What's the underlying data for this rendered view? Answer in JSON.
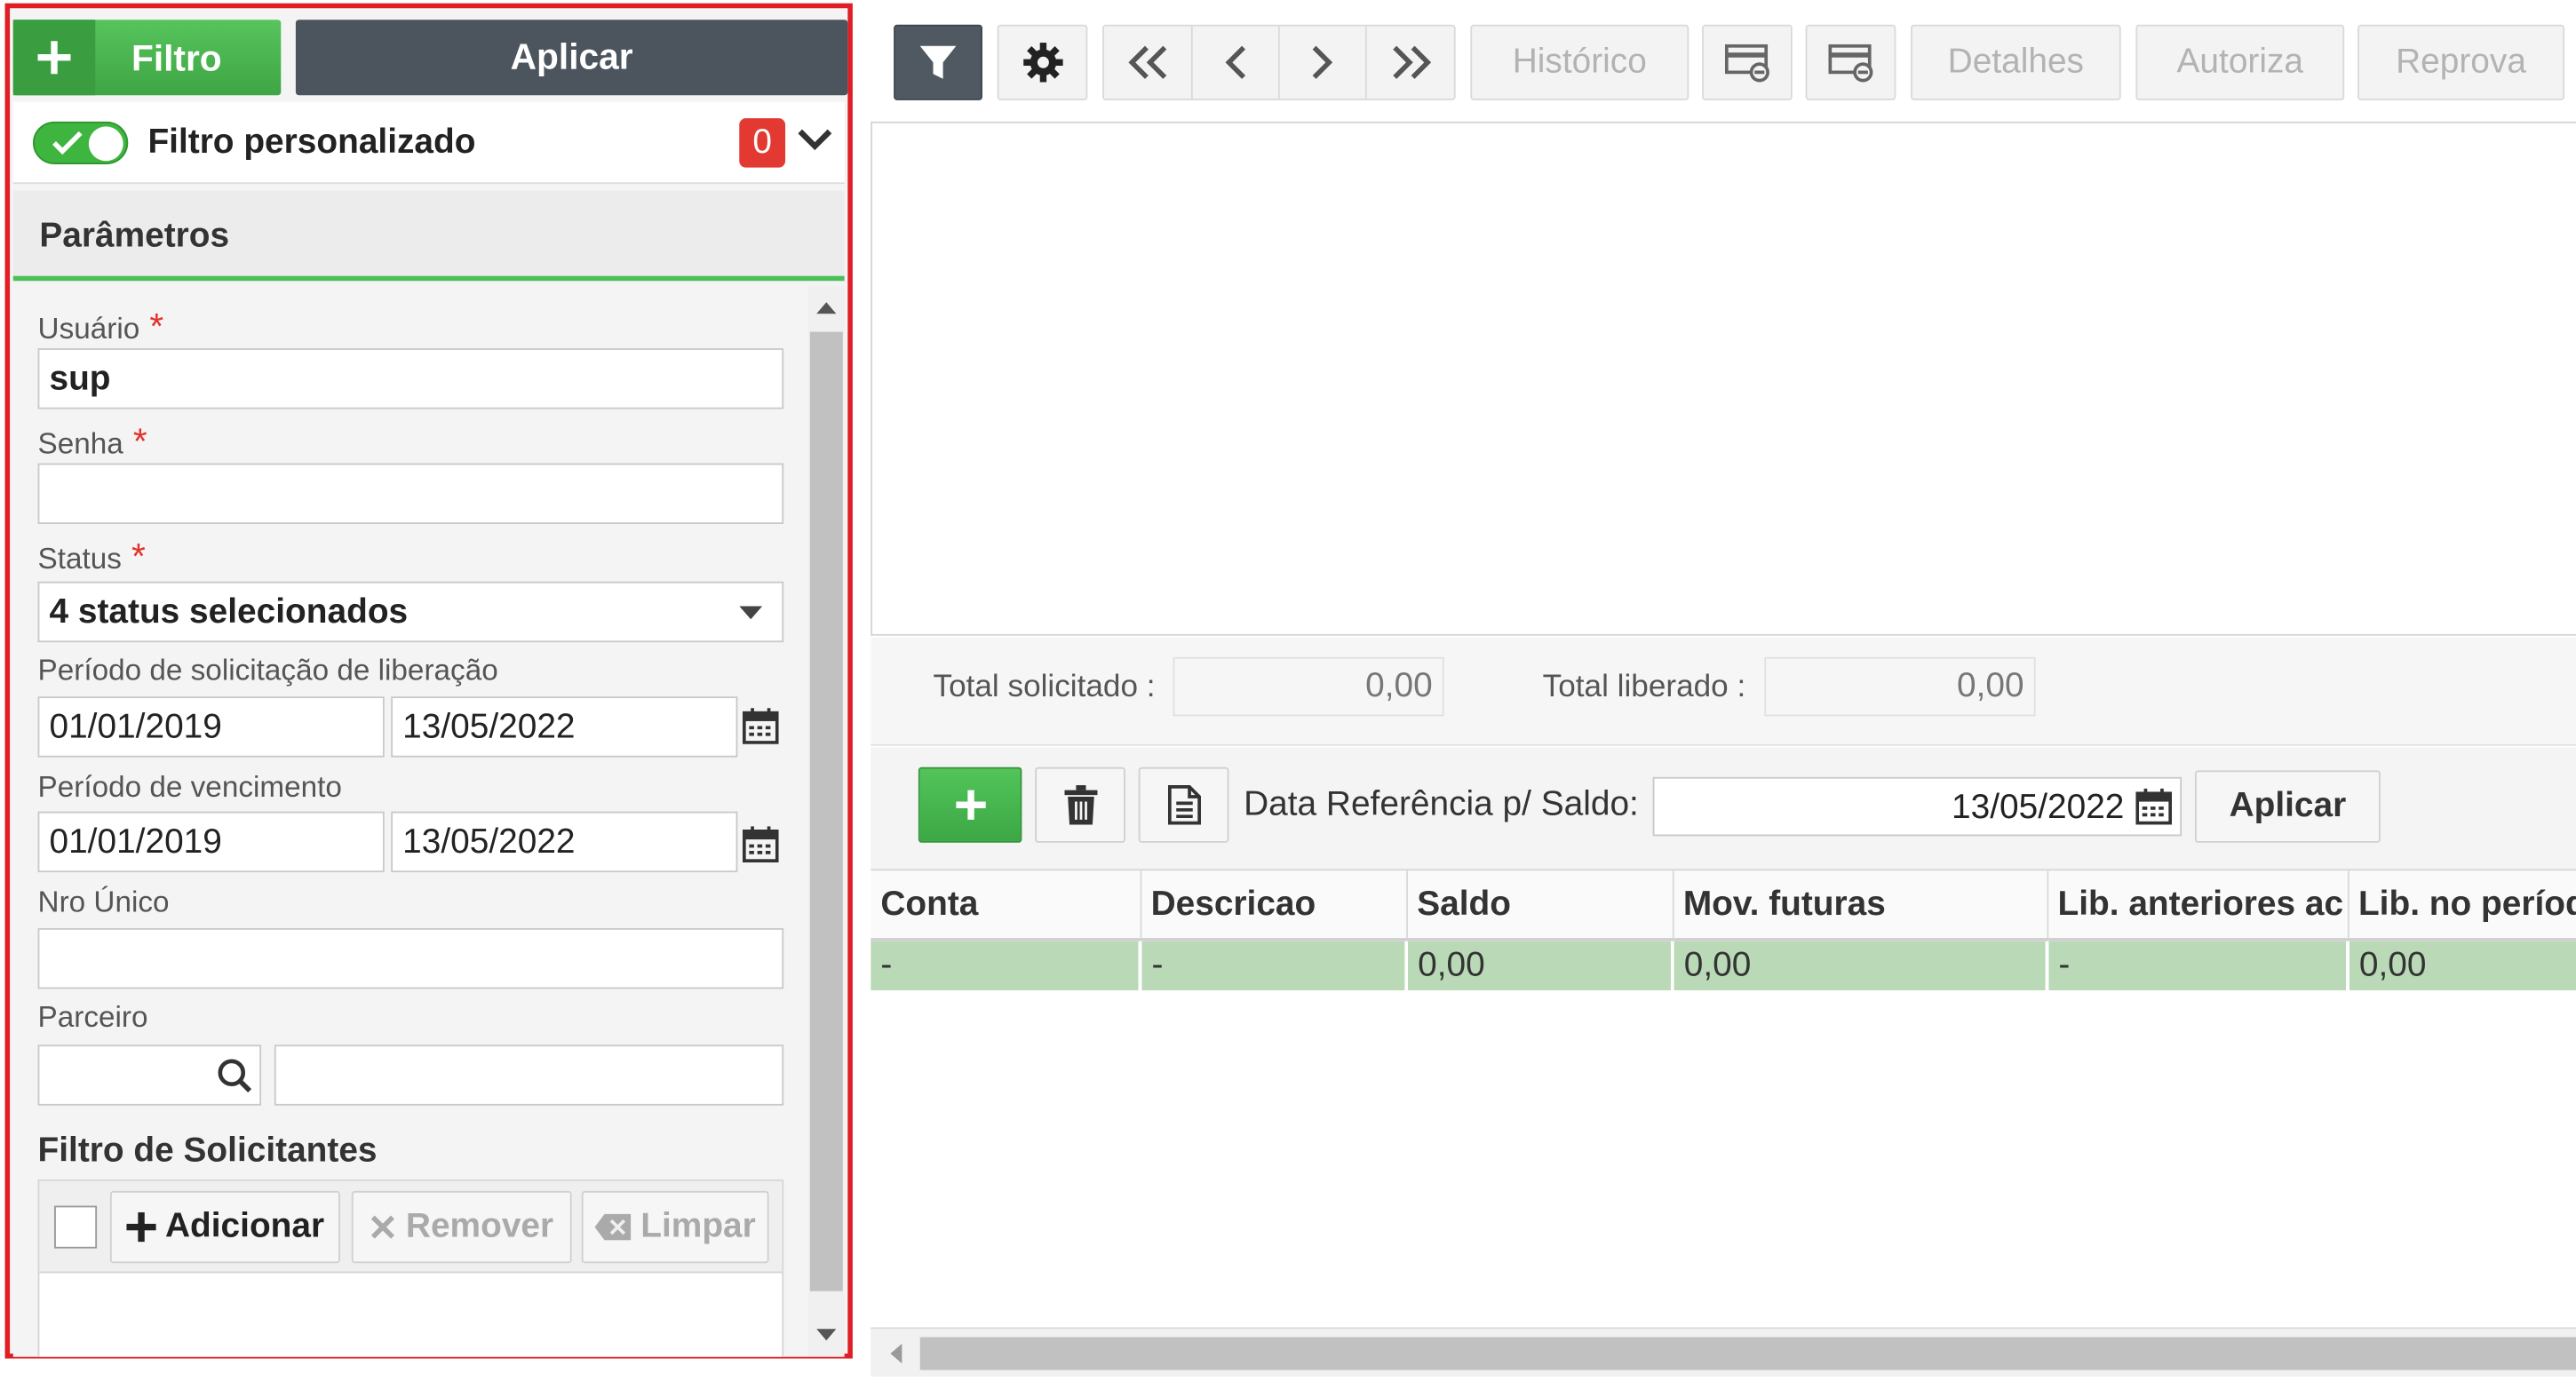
{
  "filter_panel": {
    "filtro_button": "Filtro",
    "aplicar_button": "Aplicar",
    "custom_filter_label": "Filtro personalizado",
    "custom_filter_count": "0",
    "params_title": "Parâmetros",
    "required_mark": "*",
    "usuario": {
      "label": "Usuário",
      "value": "sup"
    },
    "senha": {
      "label": "Senha",
      "value": ""
    },
    "status": {
      "label": "Status",
      "value": "4 status selecionados"
    },
    "periodo_solicitacao": {
      "label": "Período de solicitação de liberação",
      "from": "01/01/2019",
      "to": "13/05/2022"
    },
    "periodo_vencimento": {
      "label": "Período de vencimento",
      "from": "01/01/2019",
      "to": "13/05/2022"
    },
    "nro_unico": {
      "label": "Nro Único",
      "value": ""
    },
    "parceiro": {
      "label": "Parceiro",
      "code": "",
      "name": ""
    },
    "solicitantes": {
      "title": "Filtro de Solicitantes",
      "adicionar": "Adicionar",
      "remover": "Remover",
      "limpar": "Limpar"
    }
  },
  "toolbar": {
    "historico": "Histórico",
    "detalhes": "Detalhes",
    "autoriza": "Autoriza",
    "reprova": "Reprova"
  },
  "totals": {
    "solicitado_label": "Total solicitado :",
    "solicitado_value": "0,00",
    "liberado_label": "Total liberado :",
    "liberado_value": "0,00"
  },
  "saldo_bar": {
    "label": "Data Referência p/ Saldo:",
    "date": "13/05/2022",
    "aplicar": "Aplicar"
  },
  "grid": {
    "columns": [
      "Conta",
      "Descricao",
      "Saldo",
      "Mov. futuras",
      "Lib. anteriores ac",
      "Lib. no período"
    ],
    "rows": [
      [
        "-",
        "-",
        "0,00",
        "0,00",
        "-",
        "0,00"
      ]
    ]
  },
  "colors": {
    "accent_green": "#3ea544",
    "highlight_border": "#e01e25",
    "badge_red": "#e23a32",
    "dark_button": "#4c545e",
    "row_green": "#b9d9b7"
  }
}
